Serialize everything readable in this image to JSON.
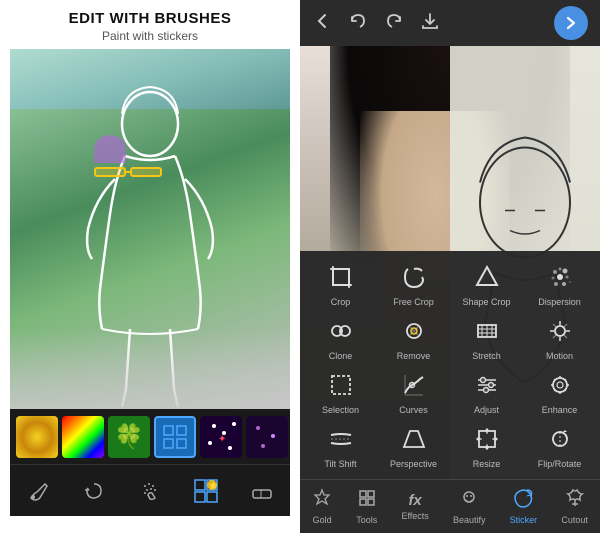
{
  "left": {
    "header": {
      "title": "EDIT WITH BRUSHES",
      "subtitle": "Paint with stickers"
    },
    "stickers": [
      {
        "id": "gold",
        "type": "gold",
        "label": "Gold glitter"
      },
      {
        "id": "rainbow",
        "type": "rainbow",
        "label": "Rainbow"
      },
      {
        "id": "clover",
        "type": "clover",
        "label": "Clover"
      },
      {
        "id": "selected",
        "type": "selected",
        "label": "Brush selected"
      },
      {
        "id": "sparkle",
        "type": "sparkle",
        "label": "Sparkle"
      },
      {
        "id": "dark",
        "type": "dark",
        "label": "Dark glitter"
      }
    ],
    "toolbar_icons": [
      {
        "name": "brush-icon",
        "symbol": "✏",
        "active": false
      },
      {
        "name": "lasso-icon",
        "symbol": "⌖",
        "active": false
      },
      {
        "name": "sparkle-icon",
        "symbol": "✦",
        "active": false
      },
      {
        "name": "sticker-brush-icon",
        "symbol": "⬡",
        "active": true
      },
      {
        "name": "eraser-icon",
        "symbol": "⬜",
        "active": false
      }
    ]
  },
  "right": {
    "topbar": {
      "back_label": "←",
      "undo_label": "↩",
      "redo_label": "↪",
      "download_label": "↓",
      "forward_label": "→"
    },
    "tools": [
      [
        {
          "name": "crop",
          "label": "Crop",
          "icon": "crop"
        },
        {
          "name": "free-crop",
          "label": "Free Crop",
          "icon": "free-crop"
        },
        {
          "name": "shape-crop",
          "label": "Shape Crop",
          "icon": "shape-crop"
        },
        {
          "name": "dispersion",
          "label": "Dispersion",
          "icon": "dispersion"
        }
      ],
      [
        {
          "name": "clone",
          "label": "Clone",
          "icon": "clone"
        },
        {
          "name": "remove",
          "label": "Remove",
          "icon": "remove"
        },
        {
          "name": "stretch",
          "label": "Stretch",
          "icon": "stretch"
        },
        {
          "name": "motion",
          "label": "Motion",
          "icon": "motion"
        }
      ],
      [
        {
          "name": "selection",
          "label": "Selection",
          "icon": "selection"
        },
        {
          "name": "curves",
          "label": "Curves",
          "icon": "curves"
        },
        {
          "name": "adjust",
          "label": "Adjust",
          "icon": "adjust"
        },
        {
          "name": "enhance",
          "label": "Enhance",
          "icon": "enhance"
        }
      ],
      [
        {
          "name": "tilt-shift",
          "label": "Tilt Shift",
          "icon": "tilt-shift"
        },
        {
          "name": "perspective",
          "label": "Perspective",
          "icon": "perspective"
        },
        {
          "name": "resize",
          "label": "Resize",
          "icon": "resize"
        },
        {
          "name": "flip-rotate",
          "label": "Flip/Rotate",
          "icon": "flip-rotate"
        }
      ]
    ],
    "bottom_nav": [
      {
        "name": "gold",
        "label": "Gold",
        "icon": "👑",
        "active": false
      },
      {
        "name": "tools",
        "label": "Tools",
        "icon": "⬜",
        "active": false
      },
      {
        "name": "effects",
        "label": "Effects",
        "icon": "fx",
        "active": false
      },
      {
        "name": "beautify",
        "label": "Beautify",
        "icon": "☺",
        "active": false
      },
      {
        "name": "sticker",
        "label": "Sticker",
        "icon": "⬡",
        "active": true
      },
      {
        "name": "cutout",
        "label": "Cutout",
        "icon": "✂",
        "active": false
      }
    ]
  }
}
